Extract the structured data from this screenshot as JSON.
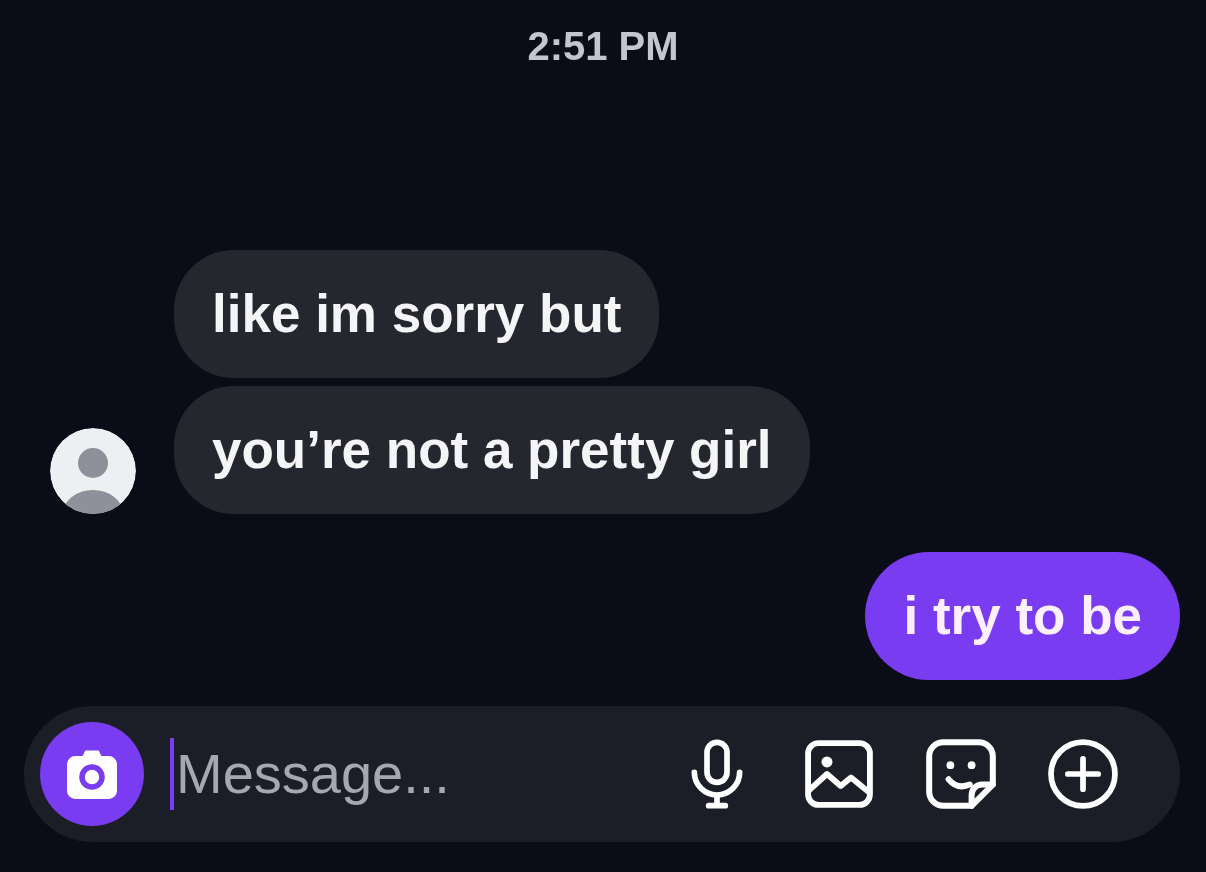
{
  "status": {
    "time": "2:51 PM"
  },
  "messages": [
    {
      "kind": "incoming",
      "text": "like im sorry but",
      "show_avatar": false
    },
    {
      "kind": "incoming",
      "text": "you’re not a pretty girl",
      "show_avatar": true
    },
    {
      "kind": "outgoing",
      "text": "i try to be"
    }
  ],
  "composer": {
    "placeholder": "Message...",
    "focused": true
  }
}
